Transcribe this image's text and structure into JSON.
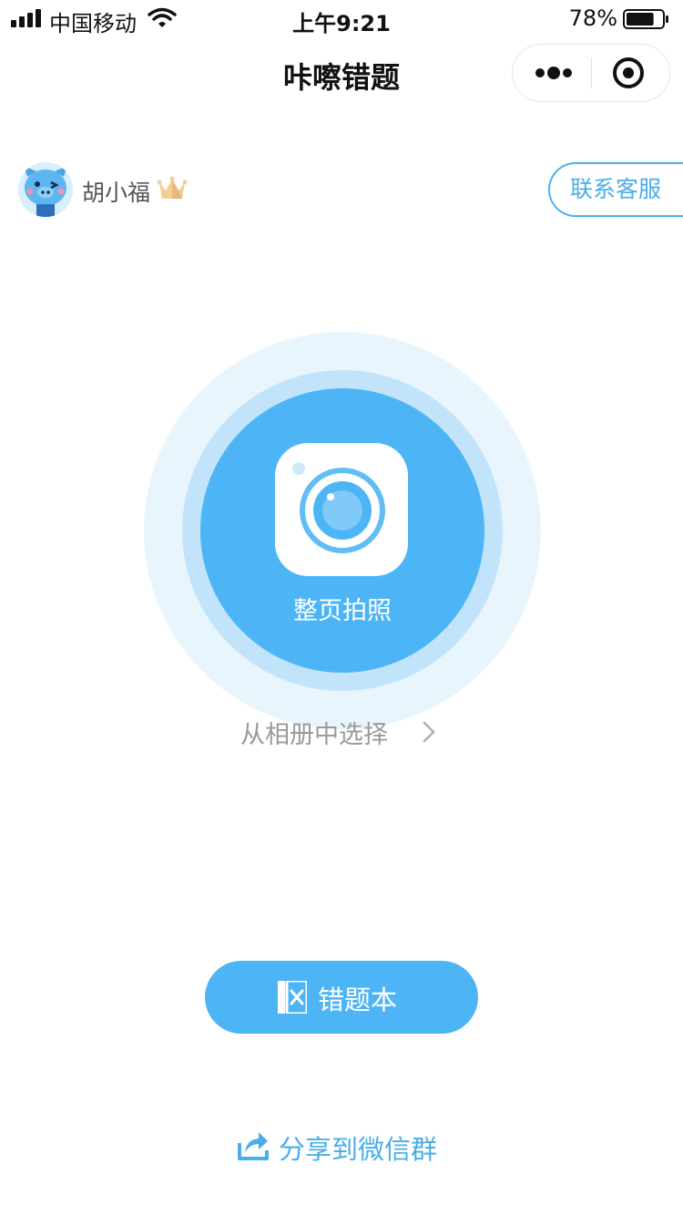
{
  "status_bar": {
    "carrier": "中国移动",
    "time": "上午9:21",
    "battery": "78%",
    "battery_level": 0.78
  },
  "nav": {
    "title": "咔嚓错题"
  },
  "user": {
    "name": "胡小福"
  },
  "service_button": "联系客服",
  "photo_button": "整页拍照",
  "album_link": "从相册中选择",
  "book_button": "错题本",
  "share_link": "分享到微信群",
  "icons": {
    "signal": "signal-icon",
    "wifi": "wifi-icon",
    "battery": "battery-icon",
    "more": "more-dots-icon",
    "target": "target-icon",
    "avatar": "pig-avatar",
    "crown": "crown-icon",
    "camera": "camera-icon",
    "chevron": "chevron-right-icon",
    "book": "book-icon",
    "share": "share-icon"
  },
  "colors": {
    "primary": "#4db5f5",
    "ring_light": "#e9f5fd",
    "ring_mid": "#c2e4fa",
    "link": "#4aaee8",
    "muted": "#9a9a9a"
  }
}
